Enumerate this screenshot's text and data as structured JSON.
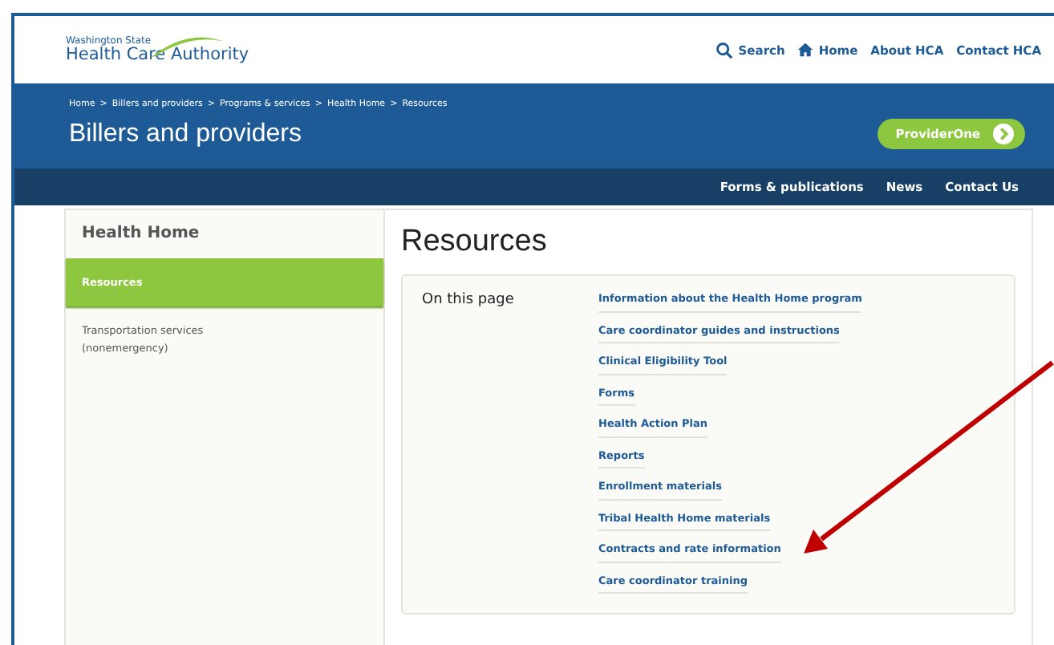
{
  "logo": {
    "top_line": "Washington State",
    "name": "Health Care Authority"
  },
  "utility_nav": [
    {
      "label": "Search",
      "kind": "search"
    },
    {
      "label": "Home",
      "kind": "home"
    },
    {
      "label": "About HCA"
    },
    {
      "label": "Contact HCA"
    }
  ],
  "breadcrumbs": [
    "Home",
    "Billers and providers",
    "Programs & services",
    "Health Home",
    "Resources"
  ],
  "breadcrumb_separator": ">",
  "section_title": "Billers and providers",
  "cta_button": "ProviderOne",
  "main_nav": [
    "Forms & publications",
    "News",
    "Contact Us"
  ],
  "sidebar": {
    "title": "Health Home",
    "items": [
      {
        "label": "Resources",
        "selected": true
      },
      {
        "label": "Transportation services (nonemergency)",
        "selected": false
      }
    ]
  },
  "page_title": "Resources",
  "on_this_page": {
    "label": "On this page",
    "links": [
      "Information about the Health Home program",
      "Care coordinator guides and instructions",
      "Clinical Eligibility Tool",
      "Forms",
      "Health Action Plan",
      "Reports",
      "Enrollment materials",
      "Tribal Health Home materials",
      "Contracts and rate information",
      "Care coordinator training"
    ]
  }
}
